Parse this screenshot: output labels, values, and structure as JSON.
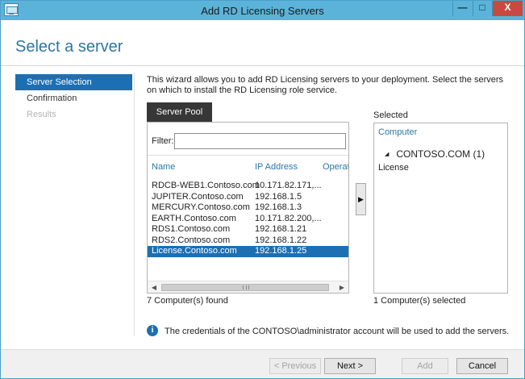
{
  "window": {
    "title": "Add RD Licensing Servers",
    "controls": {
      "minimize": "—",
      "maximize": "□",
      "close": "X"
    }
  },
  "page_title": "Select a server",
  "nav": {
    "items": [
      {
        "label": "Server Selection",
        "state": "active"
      },
      {
        "label": "Confirmation",
        "state": "normal"
      },
      {
        "label": "Results",
        "state": "disabled"
      }
    ]
  },
  "intro_text": "This wizard allows you to add RD Licensing servers to your deployment. Select the servers on which to install the RD Licensing role service.",
  "server_pool": {
    "tab_label": "Server Pool",
    "filter_label": "Filter:",
    "filter_value": "",
    "columns": {
      "name": "Name",
      "ip": "IP Address",
      "operating": "Operat"
    },
    "rows": [
      {
        "name": "RDCB-WEB1.Contoso.com",
        "ip": "10.171.82.171,..."
      },
      {
        "name": "JUPITER.Contoso.com",
        "ip": "192.168.1.5"
      },
      {
        "name": "MERCURY.Contoso.com",
        "ip": "192.168.1.3"
      },
      {
        "name": "EARTH.Contoso.com",
        "ip": "10.171.82.200,..."
      },
      {
        "name": "RDS1.Contoso.com",
        "ip": "192.168.1.21"
      },
      {
        "name": "RDS2.Contoso.com",
        "ip": "192.168.1.22"
      },
      {
        "name": "License.Contoso.com",
        "ip": "192.168.1.25"
      }
    ],
    "selected_row": 6,
    "found_text": "7 Computer(s) found"
  },
  "add_arrow": "▶",
  "selected_pane": {
    "label": "Selected",
    "column": "Computer",
    "group": "CONTOSO.COM (1)",
    "group_toggle": "◢",
    "items": [
      "License"
    ],
    "count_text": "1 Computer(s) selected"
  },
  "info": {
    "icon": "i",
    "text": "The credentials of the CONTOSO\\administrator account will be used to add the servers."
  },
  "buttons": {
    "previous": "< Previous",
    "next": "Next >",
    "add": "Add",
    "cancel": "Cancel"
  }
}
